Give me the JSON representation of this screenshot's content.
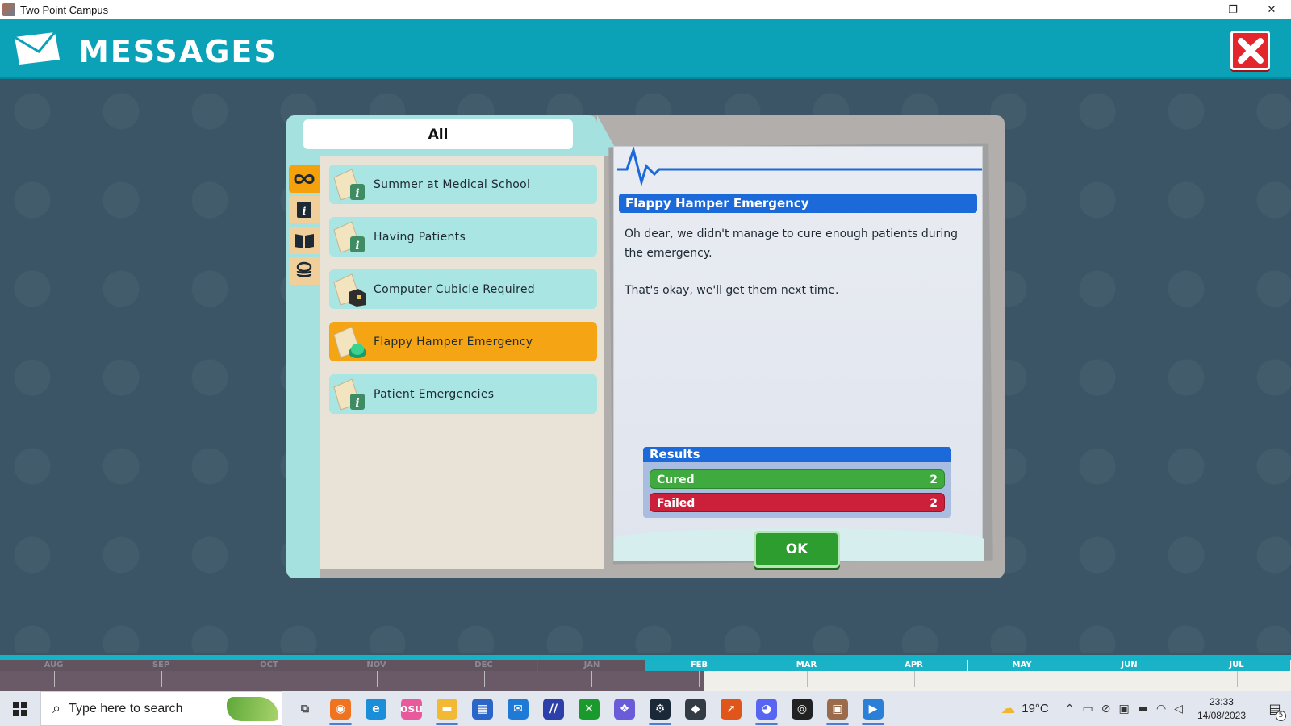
{
  "window": {
    "title": "Two Point Campus",
    "minimize": "—",
    "restore": "❐",
    "close": "✕"
  },
  "header": {
    "title": "MESSAGES",
    "icon": "envelope-icon",
    "close_icon": "close-icon",
    "accent_color": "#0ba2b8",
    "close_color": "#e3262b"
  },
  "filter": {
    "label": "All"
  },
  "categories": [
    {
      "icon": "infinity-icon",
      "active": true
    },
    {
      "icon": "info-book-icon",
      "active": false
    },
    {
      "icon": "open-book-icon",
      "active": false
    },
    {
      "icon": "coins-icon",
      "active": false
    }
  ],
  "messages": [
    {
      "label": "Summer at Medical School",
      "icon": "info-letter-icon",
      "selected": false
    },
    {
      "label": "Having Patients",
      "icon": "info-letter-icon",
      "selected": false
    },
    {
      "label": "Computer Cubicle Required",
      "icon": "cubicle-letter-icon",
      "selected": false
    },
    {
      "label": "Flappy Hamper Emergency",
      "icon": "emergency-letter-icon",
      "selected": true
    },
    {
      "label": "Patient Emergencies",
      "icon": "info-letter-icon",
      "selected": false
    }
  ],
  "detail": {
    "title": "Flappy Hamper Emergency",
    "paragraphs": [
      "Oh dear, we didn't manage to cure enough patients during the emergency.",
      "That's okay, we'll get them next time."
    ],
    "results": {
      "heading": "Results",
      "cured_label": "Cured",
      "cured_value": "2",
      "failed_label": "Failed",
      "failed_value": "2"
    },
    "ok_label": "OK"
  },
  "timeline": {
    "months": [
      "AUG",
      "SEP",
      "OCT",
      "NOV",
      "DEC",
      "JAN",
      "FEB",
      "MAR",
      "APR",
      "MAY",
      "JUN",
      "JUL"
    ],
    "current_month_index": 6
  },
  "taskbar": {
    "search_placeholder": "Type here to search",
    "apps": [
      {
        "icon": "task-view-icon",
        "color": "#e2e6ef",
        "glyph": "⧉",
        "open": false
      },
      {
        "icon": "firefox-icon",
        "color": "#f0731f",
        "glyph": "◉",
        "open": true
      },
      {
        "icon": "edge-icon",
        "color": "#1a8ed8",
        "glyph": "e",
        "open": false
      },
      {
        "icon": "osu-icon",
        "color": "#e85a9b",
        "glyph": "osu",
        "open": false
      },
      {
        "icon": "file-explorer-icon",
        "color": "#f2b935",
        "glyph": "▬",
        "open": true
      },
      {
        "icon": "store-icon",
        "color": "#2b65c8",
        "glyph": "▦",
        "open": false
      },
      {
        "icon": "mail-icon",
        "color": "#1f7ad6",
        "glyph": "✉",
        "open": false
      },
      {
        "icon": "affinity-icon",
        "color": "#2d3fa8",
        "glyph": "//",
        "open": false
      },
      {
        "icon": "xbox-icon",
        "color": "#1a9a2d",
        "glyph": "✕",
        "open": false
      },
      {
        "icon": "copilot-icon",
        "color": "#6a5bd9",
        "glyph": "❖",
        "open": false
      },
      {
        "icon": "steam-icon",
        "color": "#1b2838",
        "glyph": "⚙",
        "open": true
      },
      {
        "icon": "unity-icon",
        "color": "#333b44",
        "glyph": "◆",
        "open": false
      },
      {
        "icon": "arrow-app-icon",
        "color": "#e0561a",
        "glyph": "➚",
        "open": false
      },
      {
        "icon": "discord-icon",
        "color": "#5865f2",
        "glyph": "◕",
        "open": true
      },
      {
        "icon": "obs-icon",
        "color": "#222222",
        "glyph": "◎",
        "open": false
      },
      {
        "icon": "two-point-campus-icon",
        "color": "#9a6c4c",
        "glyph": "▣",
        "open": true
      },
      {
        "icon": "media-player-icon",
        "color": "#2a7fd6",
        "glyph": "▶",
        "open": true
      }
    ],
    "weather": "19°C",
    "time": "23:33",
    "date": "14/08/2023",
    "notification_count": "5"
  }
}
